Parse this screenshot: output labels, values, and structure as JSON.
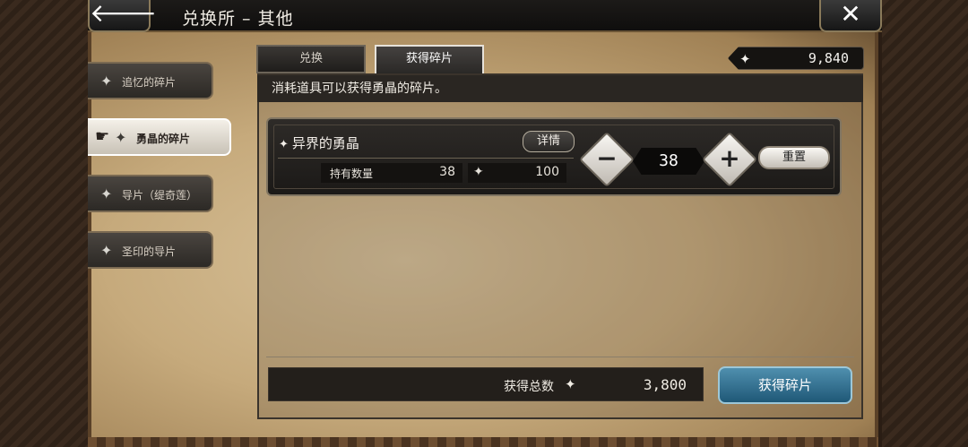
{
  "header": {
    "title": "兑换所 – 其他",
    "back_glyph": "🡐",
    "close_glyph": "✕"
  },
  "currency": {
    "icon": "diamond-icon",
    "value": "9,840"
  },
  "tabs": [
    {
      "label": "兑换",
      "active": false
    },
    {
      "label": "获得碎片",
      "active": true
    }
  ],
  "sidebar": {
    "items": [
      {
        "label": "追忆的碎片",
        "active": false
      },
      {
        "label": "勇晶的碎片",
        "active": true
      },
      {
        "label": "导片（缇奇莲）",
        "active": false
      },
      {
        "label": "圣印的导片",
        "active": false
      }
    ]
  },
  "description": "消耗道具可以获得勇晶的碎片。",
  "item": {
    "name": "异界的勇晶",
    "detail_label": "详情",
    "owned_label": "持有数量",
    "owned_value": "38",
    "max_value": "100",
    "quantity": "38",
    "reset_label": "重置"
  },
  "footer": {
    "total_label": "获得总数",
    "total_value": "3,800",
    "get_button_label": "获得碎片"
  },
  "glyphs": {
    "diamond": "✦",
    "hand": "☛",
    "minus": "−",
    "plus": "+"
  },
  "colors": {
    "accent_blue": "#2a6a8c",
    "parchment": "#c6aa7c"
  }
}
